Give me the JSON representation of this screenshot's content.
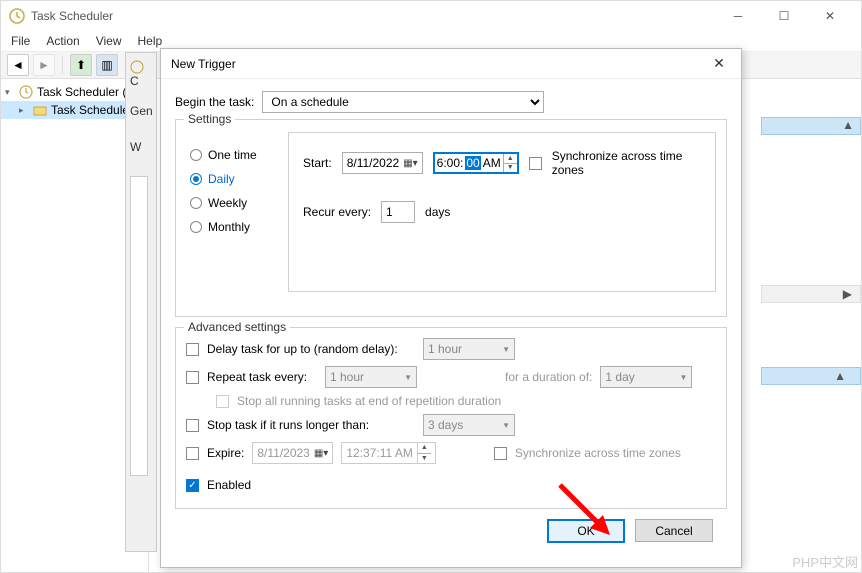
{
  "window": {
    "title": "Task Scheduler",
    "menus": [
      "File",
      "Action",
      "View",
      "Help"
    ]
  },
  "tree": {
    "root": "Task Scheduler (L",
    "child": "Task Schedule"
  },
  "dialog": {
    "title": "New Trigger",
    "begin_label": "Begin the task:",
    "begin_value": "On a schedule",
    "settings_legend": "Settings",
    "schedule_options": {
      "one_time": "One time",
      "daily": "Daily",
      "weekly": "Weekly",
      "monthly": "Monthly"
    },
    "selected_schedule": "daily",
    "start_label": "Start:",
    "start_date": "8/11/2022",
    "start_time_h": "6:00:",
    "start_time_sel": "00",
    "start_time_ampm": " AM",
    "sync_tz": "Synchronize across time zones",
    "recur_label": "Recur every:",
    "recur_value": "1",
    "recur_unit": "days",
    "advanced_legend": "Advanced settings",
    "delay_label": "Delay task for up to (random delay):",
    "delay_value": "1 hour",
    "repeat_label": "Repeat task every:",
    "repeat_value": "1 hour",
    "duration_label": "for a duration of:",
    "duration_value": "1 day",
    "stop_all_label": "Stop all running tasks at end of repetition duration",
    "stop_if_label": "Stop task if it runs longer than:",
    "stop_if_value": "3 days",
    "expire_label": "Expire:",
    "expire_date": "8/11/2023",
    "expire_time": "12:37:11 AM",
    "sync_tz2": "Synchronize across time zones",
    "enabled_label": "Enabled",
    "ok": "OK",
    "cancel": "Cancel"
  },
  "truncated": {
    "gen": "Gen",
    "w": "W"
  },
  "watermark": "PHP中文网"
}
